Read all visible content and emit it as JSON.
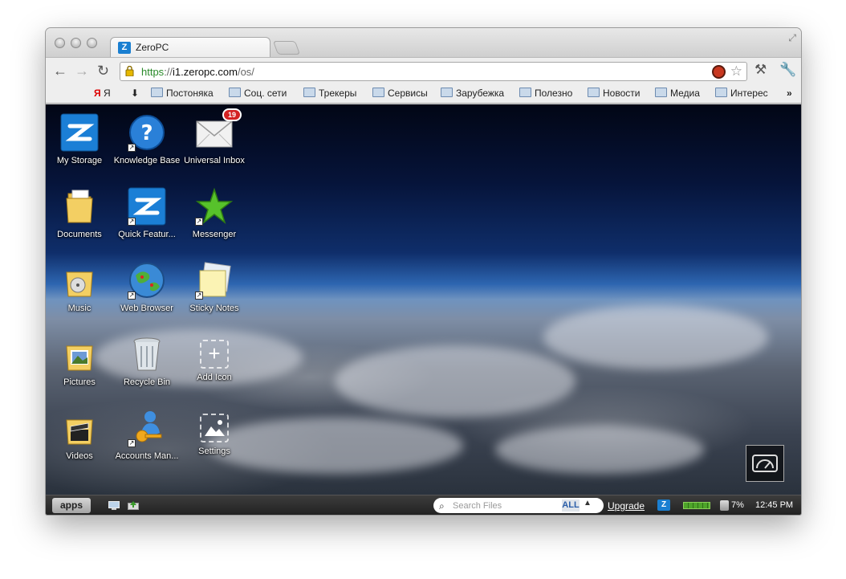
{
  "browser": {
    "tab_title": "ZeroPC",
    "url_scheme": "https",
    "url_sep": "://",
    "url_host": "i1.zeropc.com",
    "url_path": "/os/",
    "bookmarks": [
      "Я",
      "Постоняка",
      "Соц. сети",
      "Трекеры",
      "Сервисы",
      "Зарубежка",
      "Полезно",
      "Новости",
      "Медиа",
      "Интерес"
    ],
    "more_bookmarks": "»"
  },
  "desktop": {
    "icons": [
      {
        "label": "My Storage",
        "icon": "zeropc-logo-icon"
      },
      {
        "label": "Knowledge Base",
        "icon": "question-icon"
      },
      {
        "label": "Universal Inbox",
        "icon": "mail-icon",
        "badge": "19"
      },
      {
        "label": "Documents",
        "icon": "folder-icon"
      },
      {
        "label": "Quick Featur...",
        "icon": "zeropc-logo-icon"
      },
      {
        "label": "Messenger",
        "icon": "star-icon"
      },
      {
        "label": "Music",
        "icon": "music-folder-icon"
      },
      {
        "label": "Web Browser",
        "icon": "globe-icon"
      },
      {
        "label": "Sticky Notes",
        "icon": "sticky-notes-icon"
      },
      {
        "label": "Pictures",
        "icon": "pictures-folder-icon"
      },
      {
        "label": "Recycle Bin",
        "icon": "trash-icon"
      },
      {
        "label": "Add Icon",
        "icon": "plus-icon"
      },
      {
        "label": "Videos",
        "icon": "videos-folder-icon"
      },
      {
        "label": "Accounts Man...",
        "icon": "key-user-icon"
      },
      {
        "label": "Settings",
        "icon": "settings-icon"
      }
    ]
  },
  "taskbar": {
    "apps_label": "apps",
    "search_placeholder": "Search Files",
    "search_scope": "ALL",
    "upgrade_label": "Upgrade",
    "usage_percent": "7%",
    "clock": "12:45 PM"
  },
  "colors": {
    "accent": "#1a7fd1",
    "badge": "#d32222",
    "secure_green": "#2a8a2a"
  }
}
